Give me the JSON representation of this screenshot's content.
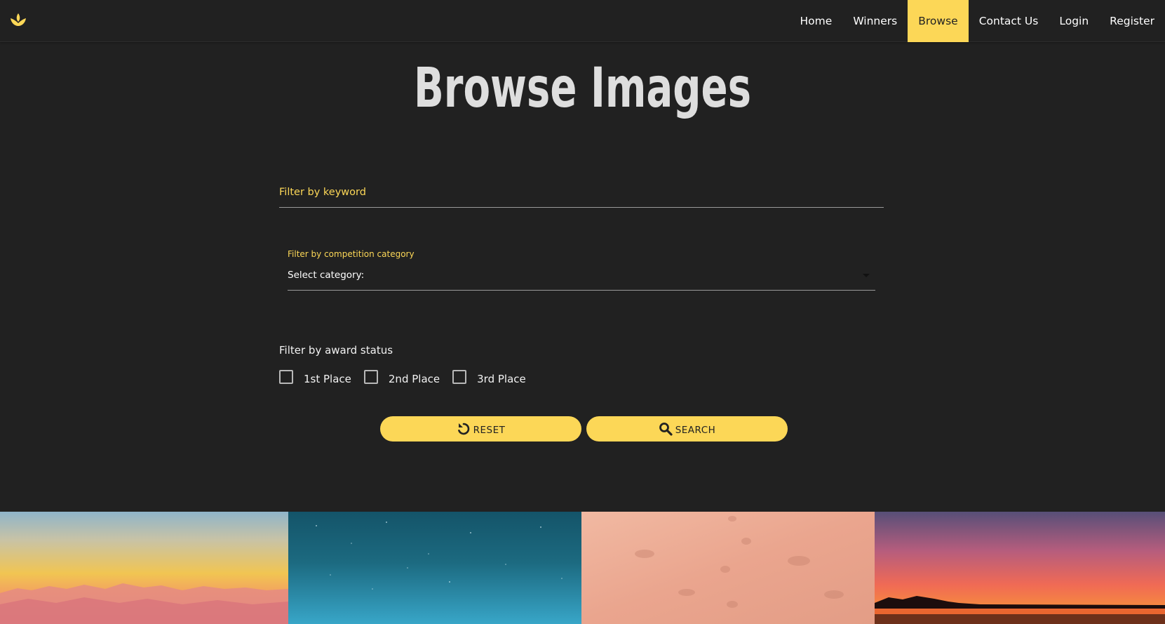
{
  "nav": {
    "logo": "lotus-icon",
    "links": [
      {
        "label": "Home",
        "active": false
      },
      {
        "label": "Winners",
        "active": false
      },
      {
        "label": "Browse",
        "active": true
      },
      {
        "label": "Contact Us",
        "active": false
      },
      {
        "label": "Login",
        "active": false
      },
      {
        "label": "Register",
        "active": false
      }
    ]
  },
  "page": {
    "title": "Browse Images"
  },
  "filters": {
    "keyword": {
      "placeholder": "Filter by keyword",
      "value": ""
    },
    "category": {
      "label": "Filter by competition category",
      "selected": "Select category:"
    },
    "award": {
      "label": "Filter by award status",
      "options": [
        {
          "label": "1st Place",
          "checked": false
        },
        {
          "label": "2nd Place",
          "checked": false
        },
        {
          "label": "3rd Place",
          "checked": false
        }
      ]
    }
  },
  "buttons": {
    "reset": {
      "label": "RESET",
      "icon": "undo-icon"
    },
    "search": {
      "label": "SEARCH",
      "icon": "search-icon"
    }
  },
  "gallery": {
    "images": [
      {
        "subject": "sunset-mountains"
      },
      {
        "subject": "starry-teal-sky"
      },
      {
        "subject": "footprints-in-sand"
      },
      {
        "subject": "lake-sunset"
      }
    ]
  },
  "colors": {
    "background": "#212121",
    "accent": "#fcd757",
    "text": "#ffffff"
  }
}
